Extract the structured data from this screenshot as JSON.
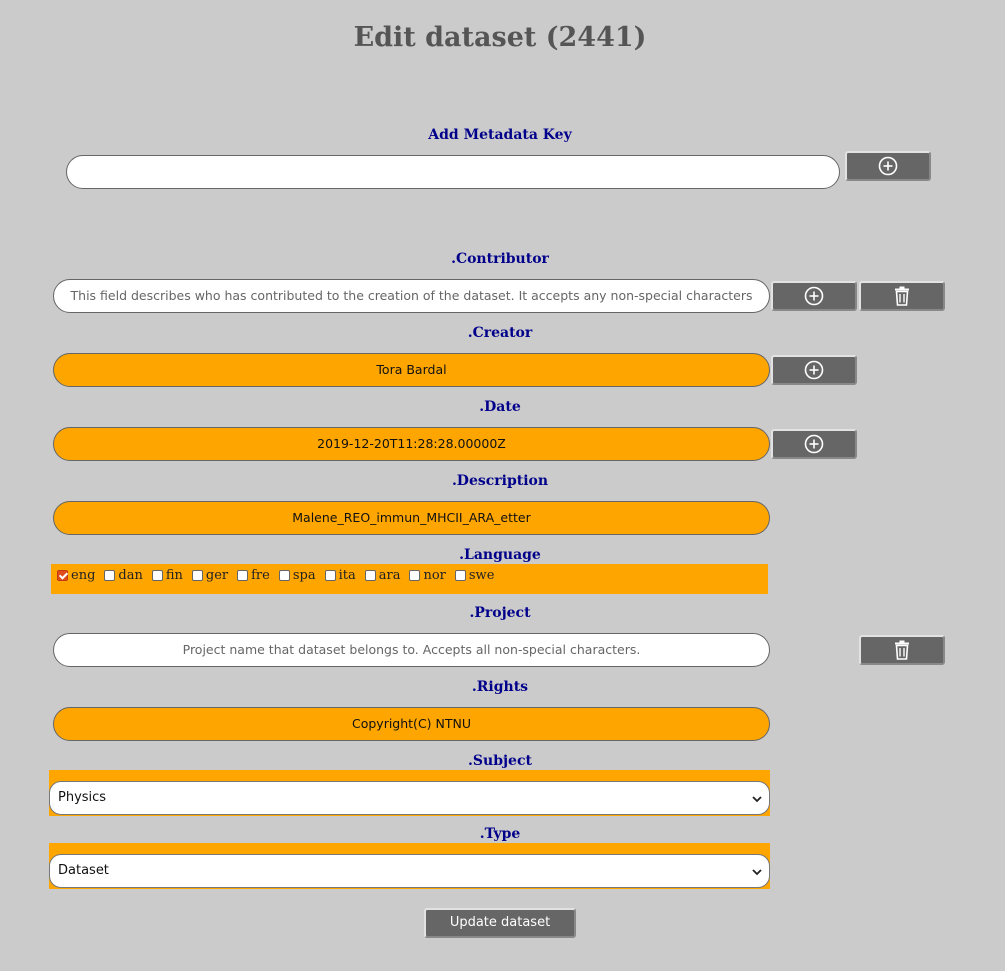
{
  "page": {
    "title": "Edit dataset (2441)"
  },
  "add_key": {
    "label": "Add Metadata Key",
    "value": ""
  },
  "fields": {
    "contributor": {
      "label": ".Contributor",
      "placeholder": "This field describes who has contributed to the creation of the dataset. It accepts any non-special characters"
    },
    "creator": {
      "label": ".Creator",
      "value": "Tora Bardal"
    },
    "date": {
      "label": ".Date",
      "value": "2019-12-20T11:28:28.00000Z"
    },
    "description": {
      "label": ".Description",
      "value": "Malene_REO_immun_MHCII_ARA_etter"
    },
    "language": {
      "label": ".Language",
      "options": [
        {
          "code": "eng",
          "checked": true
        },
        {
          "code": "dan",
          "checked": false
        },
        {
          "code": "fin",
          "checked": false
        },
        {
          "code": "ger",
          "checked": false
        },
        {
          "code": "fre",
          "checked": false
        },
        {
          "code": "spa",
          "checked": false
        },
        {
          "code": "ita",
          "checked": false
        },
        {
          "code": "ara",
          "checked": false
        },
        {
          "code": "nor",
          "checked": false
        },
        {
          "code": "swe",
          "checked": false
        }
      ]
    },
    "project": {
      "label": ".Project",
      "placeholder": "Project name that dataset belongs to. Accepts all non-special characters."
    },
    "rights": {
      "label": ".Rights",
      "value": "Copyright(C) NTNU"
    },
    "subject": {
      "label": ".Subject",
      "selected": "Physics"
    },
    "type": {
      "label": ".Type",
      "selected": "Dataset"
    }
  },
  "update_button": {
    "label": "Update dataset"
  },
  "icons": {
    "add": "plus-circle-icon",
    "delete": "trash-icon"
  },
  "colors": {
    "filled_field": "#ffa500",
    "label": "#00008b",
    "button": "#666666",
    "checkbox_checked": "#e04c1a"
  }
}
